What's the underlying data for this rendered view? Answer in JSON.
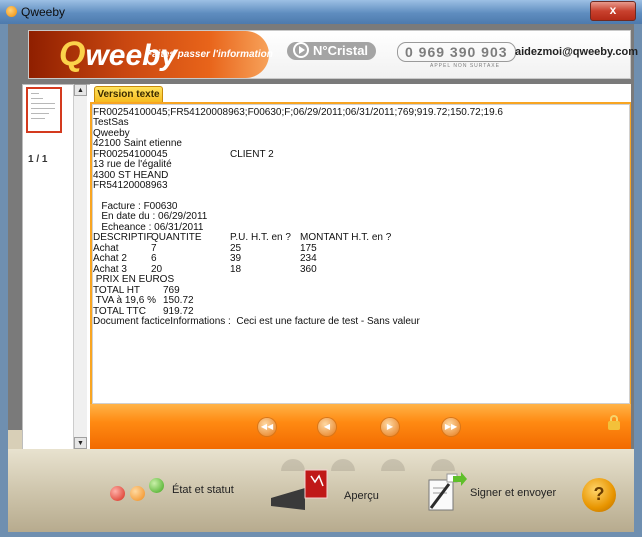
{
  "window": {
    "title": "Qweeby",
    "close_label": "x"
  },
  "header": {
    "logo_first": "Q",
    "logo_rest": "weeby",
    "tagline": "Faites passer l'information",
    "cristal_label": "N°Cristal",
    "phone": "0 969 390 903",
    "phone_sub": "APPEL NON SURTAXE",
    "email": "aidezmoi@qweeby.com"
  },
  "sidebar": {
    "page_indicator": "1 / 1"
  },
  "document": {
    "tab_label": "Version texte",
    "lines": [
      "FR00254100045;FR54120008963;F00630;F;06/29/2011;06/31/2011;769;919.72;150.72;19.6",
      "TestSas",
      "Qweeby",
      "42100 Saint etienne",
      "FR00254100045",
      "13 rue de l'égalité",
      "4300 ST HEAND",
      "FR54120008963",
      "",
      "   Facture : F00630",
      "   En date du : 06/29/2011",
      "   Echeance : 06/31/2011",
      "DESCRIPTIF",
      "Achat",
      "Achat 2",
      "Achat 3",
      " PRIX EN EUROS",
      "TOTAL HT",
      " TVA à 19,6 %",
      "TOTAL TTC",
      "Document facticeInformations :  Ceci est une facture de test - Sans valeur"
    ],
    "client_label": "CLIENT 2",
    "table_headers": [
      "QUANTITE",
      "P.U. H.T. en ?",
      "MONTANT H.T. en ?"
    ],
    "rows": [
      [
        "7",
        "25",
        "175"
      ],
      [
        "6",
        "39",
        "234"
      ],
      [
        "20",
        "18",
        "360"
      ]
    ],
    "totals": [
      "769",
      "150.72",
      "919.72"
    ]
  },
  "toolbar": {
    "status_label": "État et statut",
    "preview_label": "Aperçu",
    "sign_label": "Signer et envoyer",
    "help_label": "?"
  },
  "colors": {
    "accent": "#f28a12",
    "brand": "#c94710"
  }
}
